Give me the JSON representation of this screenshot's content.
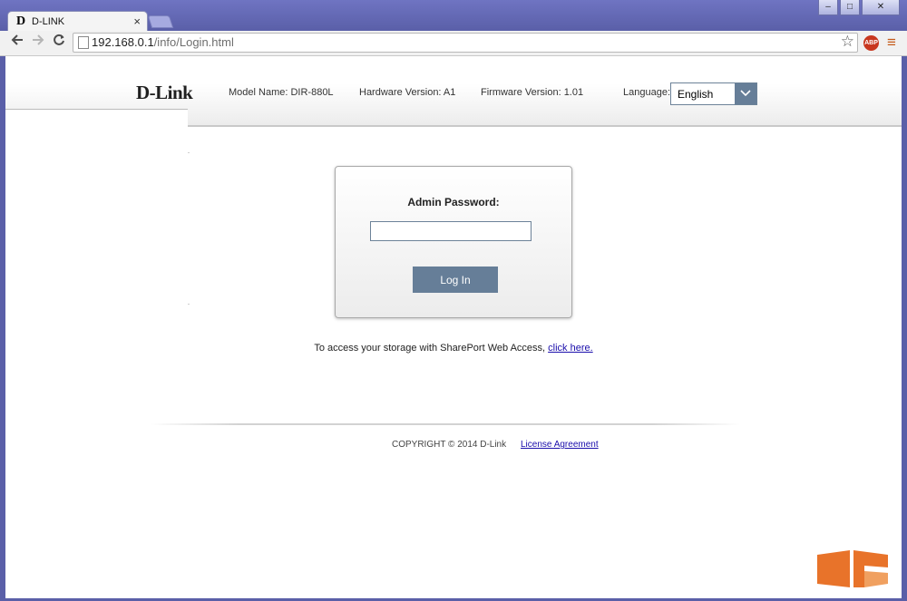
{
  "browser": {
    "tab_title": "D-LINK",
    "tab_favicon": "D",
    "tab_close": "×",
    "url_host": "192.168.0.1",
    "url_path": "/info/Login.html",
    "window_buttons": [
      "–",
      "□",
      "✕"
    ],
    "abp_label": "ABP",
    "icons": [
      "back-arrow-icon",
      "forward-arrow-icon",
      "reload-icon",
      "page-icon",
      "bookmark-star-icon",
      "adblock-icon",
      "menu-icon"
    ]
  },
  "header": {
    "logo": "D-Link",
    "model": "Model Name: DIR-880L",
    "hardware": "Hardware Version: A1",
    "firmware": "Firmware Version: 1.01",
    "language_label": "Language:",
    "language_value": "English"
  },
  "login": {
    "password_label": "Admin Password:",
    "password_value": "",
    "button_label": "Log In"
  },
  "storage": {
    "text": "To access your storage with SharePort Web Access, ",
    "link": "click here."
  },
  "footer": {
    "copyright": "COPYRIGHT © 2014 D-Link",
    "license": "License Agreement"
  },
  "colors": {
    "accent": "#667e98",
    "window_frame": "#5a5fa8",
    "link": "#1a0dab"
  }
}
